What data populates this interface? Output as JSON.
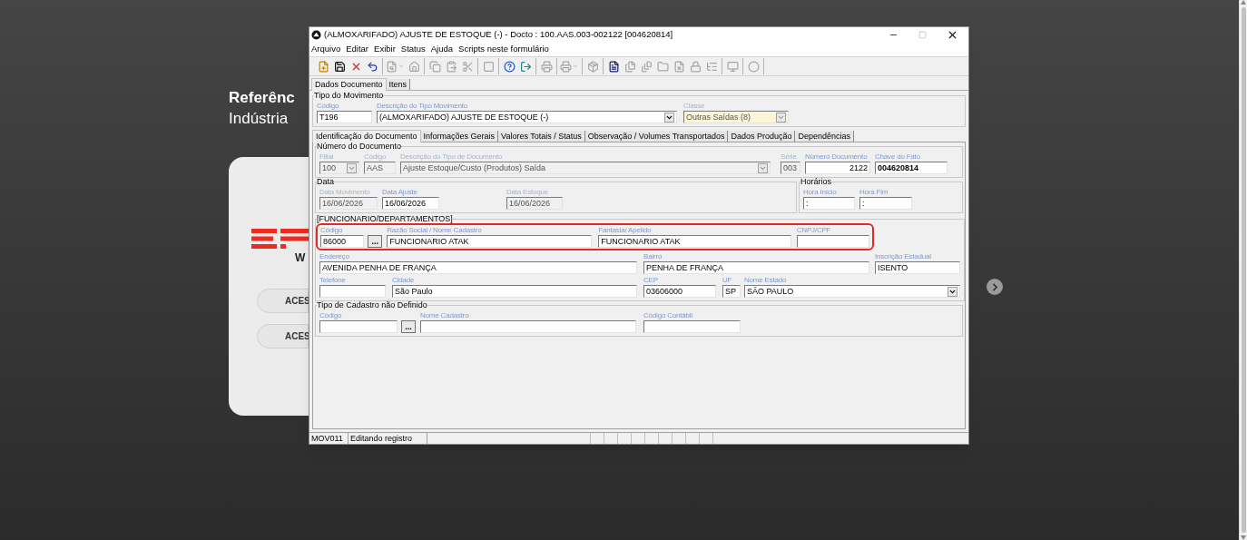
{
  "background": {
    "heading": "Referênc",
    "subheading": "Indústria",
    "logo_subtext": "W",
    "buttons": [
      "ACES",
      "ACES"
    ]
  },
  "window": {
    "title": "(ALMOXARIFADO) AJUSTE DE ESTOQUE (-) - Docto : 100.AAS.003-002122 [004620814]"
  },
  "menu": [
    "Arquivo",
    "Editar",
    "Exibir",
    "Status",
    "Ajuda",
    "Scripts neste formulário"
  ],
  "toolbar": [
    [
      {
        "disabled": false
      },
      {
        "disabled": false
      },
      {
        "disabled": false
      },
      {
        "disabled": false
      }
    ],
    [
      {
        "disabled": true
      },
      {
        "disabled": true
      }
    ],
    [
      {
        "disabled": true
      },
      {
        "disabled": true
      },
      {
        "disabled": true
      }
    ],
    [
      {
        "disabled": true
      }
    ],
    [
      {
        "disabled": false
      },
      {
        "disabled": false
      }
    ],
    [
      {
        "disabled": true
      }
    ],
    [
      {
        "disabled": true
      }
    ],
    [
      {
        "disabled": true
      }
    ],
    [
      {
        "disabled": false
      },
      {
        "disabled": true
      },
      {
        "disabled": true
      },
      {
        "disabled": true
      },
      {
        "disabled": true
      },
      {
        "disabled": true
      },
      {
        "disabled": true
      }
    ],
    [
      {
        "disabled": true
      }
    ],
    [
      {
        "disabled": true
      }
    ]
  ],
  "tabs": [
    {
      "label": "Dados Documento",
      "selected": true
    },
    {
      "label": "Itens",
      "selected": false
    }
  ],
  "movement_group": {
    "title": "Tipo do Movimento",
    "rows": [
      {
        "highlighted": false,
        "fields": [
          {
            "label": "Código",
            "value": "T196",
            "kind": "text",
            "disabled": false
          },
          {
            "label": "Descrição do Tipo Movimento",
            "value": "(ALMOXARIFADO) AJUSTE DE ESTOQUE (-)",
            "kind": "select",
            "disabled": false
          },
          {
            "label": "Classe",
            "value": "Outras Saídas (8)",
            "kind": "select",
            "disabled": true
          }
        ]
      }
    ]
  },
  "subtabs": [
    {
      "label": "Identificação do Documento",
      "selected": true
    },
    {
      "label": "Informações Gerais",
      "selected": false
    },
    {
      "label": "Valores Totais / Status",
      "selected": false
    },
    {
      "label": "Observação / Volumes Transportados",
      "selected": false
    },
    {
      "label": "Dados Produção",
      "selected": false
    },
    {
      "label": "Dependências",
      "selected": false
    }
  ],
  "groups": [
    {
      "title": "Número do Documento",
      "rows": [
        {
          "highlighted": false,
          "fields": [
            {
              "label": "Filial",
              "value": "100",
              "kind": "select",
              "disabled": true
            },
            {
              "label": "Código",
              "value": "AAS",
              "kind": "text",
              "disabled": true
            },
            {
              "label": "Descrição do Tipo de Documento",
              "value": "Ajuste Estoque/Custo (Produtos) Saída",
              "kind": "select",
              "disabled": true
            },
            {
              "label": "Série",
              "value": "003",
              "kind": "text",
              "disabled": true
            },
            {
              "label": "Número Documento",
              "value": "2122",
              "kind": "number",
              "disabled": false
            },
            {
              "label": "Chave do Fato",
              "value": "004620814",
              "kind": "key",
              "disabled": false
            }
          ]
        }
      ]
    },
    {
      "title": "Data",
      "rows": [
        {
          "highlighted": false,
          "fields": [
            {
              "label": "Data Movimento",
              "value": "16/06/2026",
              "kind": "text",
              "disabled": true
            },
            {
              "label": "Data Ajuste",
              "value": "16/06/2026",
              "kind": "text",
              "disabled": false
            },
            {
              "label": "Data Estoque",
              "value": "16/06/2026",
              "kind": "text",
              "disabled": true
            }
          ]
        }
      ]
    },
    {
      "title": "Horários",
      "rows": [
        {
          "highlighted": false,
          "fields": [
            {
              "label": "Hora Início",
              "value": ":",
              "kind": "text",
              "disabled": false
            },
            {
              "label": "Hora Fim",
              "value": ":",
              "kind": "text",
              "disabled": false
            }
          ]
        }
      ]
    },
    {
      "title": "[FUNCIONARIO/DEPARTAMENTOS]",
      "rows": [
        {
          "highlighted": true,
          "fields": [
            {
              "label": "Código",
              "value": "86000",
              "kind": "lookup",
              "button": "...",
              "disabled": false
            },
            {
              "label": "Razão Social / Nome Cadastro",
              "value": "FUNCIONARIO ATAK",
              "kind": "text",
              "disabled": false
            },
            {
              "label": "Fantasia/ Apelido",
              "value": "FUNCIONARIO ATAK",
              "kind": "text",
              "disabled": false
            },
            {
              "label": "CNPJ/CPF",
              "kind": "text",
              "disabled": false
            }
          ]
        },
        {
          "highlighted": false,
          "fields": [
            {
              "label": "Endereço",
              "value": "AVENIDA PENHA DE FRANÇA",
              "kind": "text",
              "disabled": false
            },
            {
              "label": "Bairro",
              "value": "PENHA DE FRANÇA",
              "kind": "text",
              "disabled": false
            },
            {
              "label": "Inscrição Estadual",
              "value": "ISENTO",
              "kind": "text",
              "disabled": false
            }
          ]
        },
        {
          "highlighted": false,
          "fields": [
            {
              "label": "Telefone",
              "kind": "text",
              "disabled": false
            },
            {
              "label": "Cidade",
              "value": "São Paulo",
              "kind": "text",
              "disabled": false
            },
            {
              "label": "CEP",
              "value": "03606000",
              "kind": "text",
              "disabled": false
            },
            {
              "label": "UF",
              "value": "SP",
              "kind": "text",
              "disabled": false
            },
            {
              "label": "Nome Estado",
              "value": "SÃO PAULO",
              "kind": "select",
              "disabled": false
            }
          ]
        }
      ]
    },
    {
      "title": "Tipo de Cadastro não Definido",
      "rows": [
        {
          "highlighted": false,
          "fields": [
            {
              "label": "Código",
              "kind": "lookup",
              "button": "...",
              "disabled": false
            },
            {
              "label": "Nome Cadastro",
              "kind": "text",
              "disabled": false
            },
            {
              "label": "Código Contábil",
              "kind": "text",
              "disabled": false
            }
          ]
        }
      ]
    }
  ],
  "status_bar": [
    "MOV011",
    "Editando registro"
  ]
}
